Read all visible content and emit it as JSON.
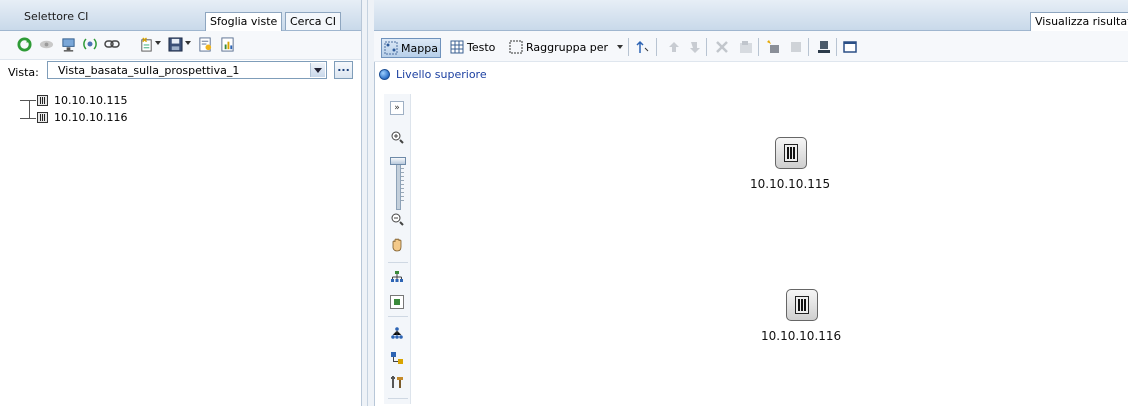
{
  "left_panel": {
    "title": "Selettore CI",
    "tabs": [
      {
        "label": "Sfoglia viste"
      },
      {
        "label": "Cerca CI"
      }
    ],
    "toolbar_icons": [
      "refresh-icon",
      "history-icon",
      "monitor-icon",
      "signal-icon",
      "link-icon",
      "new-item-icon",
      "save-icon",
      "properties-icon",
      "report-icon"
    ],
    "vista_label": "Vista:",
    "vista_value": "Vista_basata_sulla_prospettiva_1",
    "ellipsis_label": "...",
    "tree": [
      {
        "label": "10.10.10.115"
      },
      {
        "label": "10.10.10.116"
      }
    ]
  },
  "right_panel": {
    "tab": "Visualizza risultat",
    "toolbar": {
      "map_label": "Mappa",
      "text_label": "Testo",
      "group_label": "Raggruppa per"
    },
    "breadcrumb": "Livello superiore",
    "map_tools": [
      "expand-icon",
      "zoom-in-icon",
      "zoom-out-icon",
      "pan-hand-icon",
      "hierarchy-layout-icon",
      "fit-view-icon",
      "tree-layout-icon",
      "layout-settings-icon",
      "tools-icon"
    ],
    "nodes": [
      {
        "label": "10.10.10.115"
      },
      {
        "label": "10.10.10.116"
      }
    ]
  }
}
